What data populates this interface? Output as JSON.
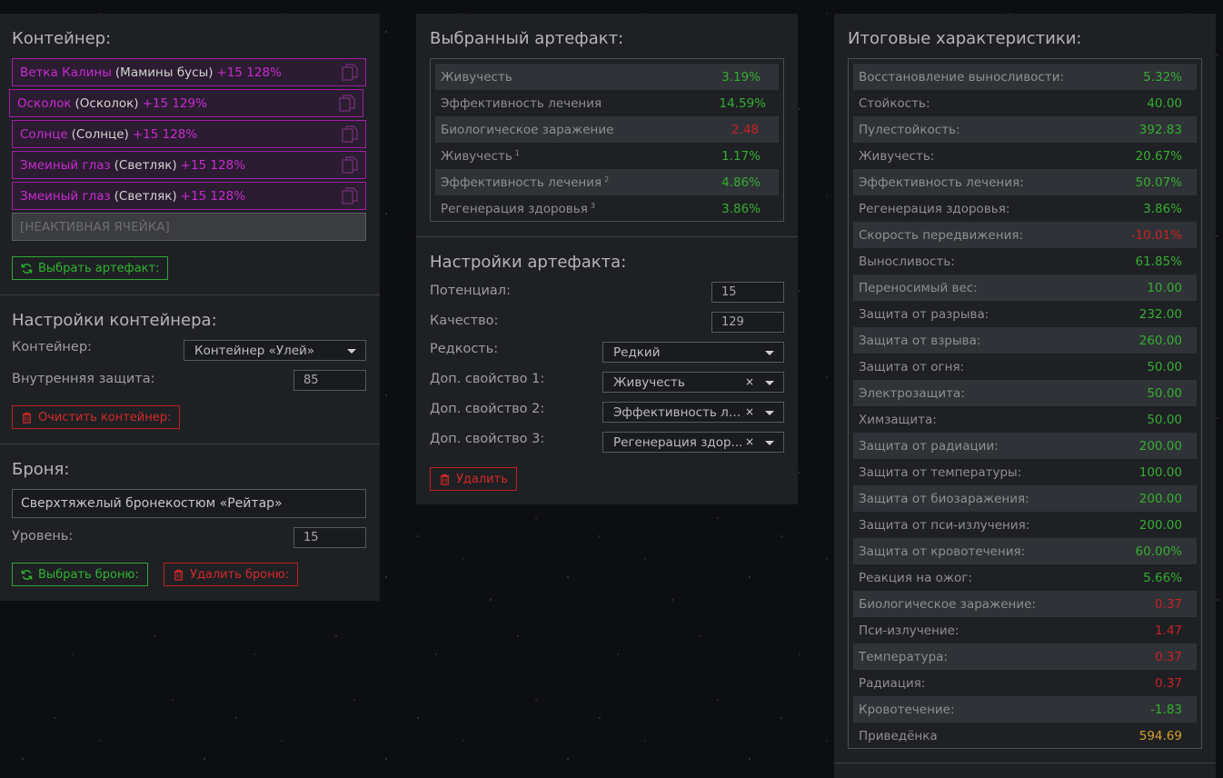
{
  "left": {
    "container_title": "Контейнер:",
    "slots": [
      {
        "name": "Ветка Калины",
        "type": "(Мамины бусы)",
        "level": "+15 128%"
      },
      {
        "name": "Осколок",
        "type": "(Осколок)",
        "level": "+15 129%"
      },
      {
        "name": "Солнце",
        "type": "(Солнце)",
        "level": "+15 128%"
      },
      {
        "name": "Змеиный глаз",
        "type": "(Светляк)",
        "level": "+15 128%"
      },
      {
        "name": "Змеиный глаз",
        "type": "(Светляк)",
        "level": "+15 128%"
      }
    ],
    "inactive_slot": "[НЕАКТИВНАЯ ЯЧЕЙКА]",
    "select_artifact_button": "Выбрать артефакт:",
    "container_settings_title": "Настройки контейнера:",
    "container_label": "Контейнер:",
    "container_value": "Контейнер «Улей»",
    "inner_protection_label": "Внутренняя защита:",
    "inner_protection_value": "85",
    "clear_container_button": "Очистить контейнер:",
    "armor_title": "Броня:",
    "armor_value": "Сверхтяжелый бронекостюм «Рейтар»",
    "level_label": "Уровень:",
    "level_value": "15",
    "select_armor_button": "Выбрать броню:",
    "delete_armor_button": "Удалить броню:"
  },
  "mid": {
    "selected_title": "Выбранный артефакт:",
    "stats": [
      {
        "label": "Живучесть",
        "sup": "",
        "value": "3.19%",
        "tone": "pos"
      },
      {
        "label": "Эффективность лечения",
        "sup": "",
        "value": "14.59%",
        "tone": "pos"
      },
      {
        "label": "Биологическое заражение",
        "sup": "",
        "value": "2.48",
        "tone": "neg"
      },
      {
        "label": "Живучесть",
        "sup": "1",
        "value": "1.17%",
        "tone": "pos"
      },
      {
        "label": "Эффективность лечения",
        "sup": "2",
        "value": "4.86%",
        "tone": "pos"
      },
      {
        "label": "Регенерация здоровья",
        "sup": "3",
        "value": "3.86%",
        "tone": "pos"
      }
    ],
    "settings_title": "Настройки артефакта:",
    "potential_label": "Потенциал:",
    "potential_value": "15",
    "quality_label": "Качество:",
    "quality_value": "129",
    "rarity_label": "Редкость:",
    "rarity_value": "Редкий",
    "prop1_label": "Доп. свойство 1:",
    "prop1_value": "Живучесть",
    "prop2_label": "Доп. свойство 2:",
    "prop2_value": "Эффективность ле...",
    "prop3_label": "Доп. свойство 3:",
    "prop3_value": "Регенерация здор...",
    "clear_symbol": "×",
    "delete_button": "Удалить"
  },
  "right": {
    "title": "Итоговые характеристики:",
    "stats": [
      {
        "label": "Восстановление выносливости:",
        "value": "5.32%",
        "tone": "pos"
      },
      {
        "label": "Стойкость:",
        "value": "40.00",
        "tone": "pos"
      },
      {
        "label": "Пулестойкость:",
        "value": "392.83",
        "tone": "pos"
      },
      {
        "label": "Живучесть:",
        "value": "20.67%",
        "tone": "pos"
      },
      {
        "label": "Эффективность лечения:",
        "value": "50.07%",
        "tone": "pos"
      },
      {
        "label": "Регенерация здоровья:",
        "value": "3.86%",
        "tone": "pos"
      },
      {
        "label": "Скорость передвижения:",
        "value": "-10.01%",
        "tone": "neg"
      },
      {
        "label": "Выносливость:",
        "value": "61.85%",
        "tone": "pos"
      },
      {
        "label": "Переносимый вес:",
        "value": "10.00",
        "tone": "pos"
      },
      {
        "label": "Защита от разрыва:",
        "value": "232.00",
        "tone": "pos"
      },
      {
        "label": "Защита от взрыва:",
        "value": "260.00",
        "tone": "pos"
      },
      {
        "label": "Защита от огня:",
        "value": "50.00",
        "tone": "pos"
      },
      {
        "label": "Электрозащита:",
        "value": "50.00",
        "tone": "pos"
      },
      {
        "label": "Химзащита:",
        "value": "50.00",
        "tone": "pos"
      },
      {
        "label": "Защита от радиации:",
        "value": "200.00",
        "tone": "pos"
      },
      {
        "label": "Защита от температуры:",
        "value": "100.00",
        "tone": "pos"
      },
      {
        "label": "Защита от биозаражения:",
        "value": "200.00",
        "tone": "pos"
      },
      {
        "label": "Защита от пси-излучения:",
        "value": "200.00",
        "tone": "pos"
      },
      {
        "label": "Защита от кровотечения:",
        "value": "60.00%",
        "tone": "pos"
      },
      {
        "label": "Реакция на ожог:",
        "value": "5.66%",
        "tone": "pos"
      },
      {
        "label": "Биологическое заражение:",
        "value": "0.37",
        "tone": "neg"
      },
      {
        "label": "Пси-излучение:",
        "value": "1.47",
        "tone": "neg"
      },
      {
        "label": "Температура:",
        "value": "0.37",
        "tone": "neg"
      },
      {
        "label": "Радиация:",
        "value": "0.37",
        "tone": "neg"
      },
      {
        "label": "Кровотечение:",
        "value": "-1.83",
        "tone": "pos"
      },
      {
        "label": "Приведёнка",
        "value": "594.69",
        "tone": "gold"
      }
    ]
  },
  "colors": {
    "panel": "#1e2024",
    "slot_border": "#a21ca8",
    "positive": "#36ad31",
    "negative": "#c72222",
    "gold": "#d4a02c"
  },
  "icons": [
    "copy-icon",
    "refresh-icon",
    "trash-icon",
    "chevron-down-icon",
    "clear-icon"
  ]
}
